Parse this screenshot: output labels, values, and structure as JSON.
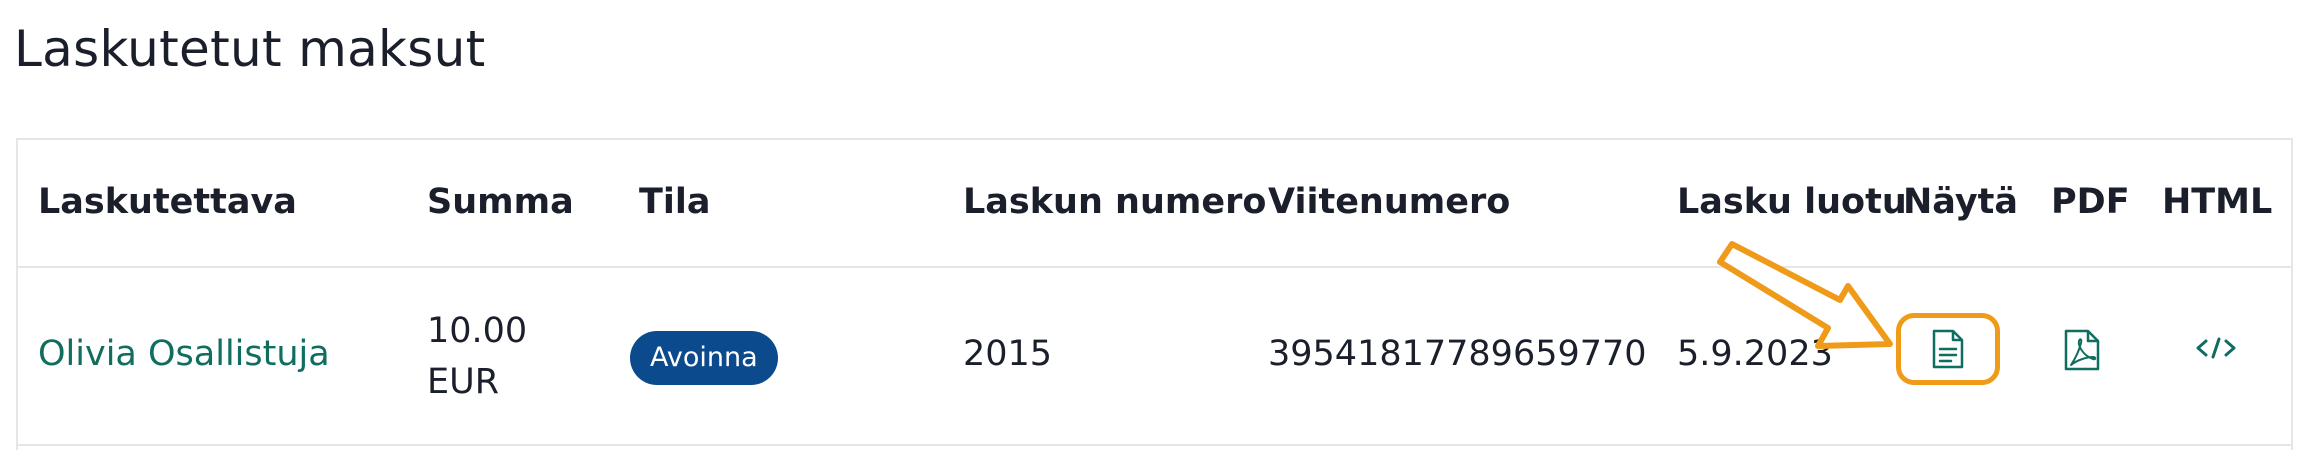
{
  "page": {
    "title": "Laskutetut maksut"
  },
  "table": {
    "headers": {
      "payer": "Laskutettava",
      "sum": "Summa",
      "status": "Tila",
      "invoice_number": "Laskun numero",
      "reference_number": "Viitenumero",
      "created": "Lasku luotu",
      "view": "Näytä",
      "pdf": "PDF",
      "html": "HTML"
    },
    "rows": [
      {
        "payer": "Olivia Osallistuja",
        "sum_amount": "10.00",
        "sum_currency": "EUR",
        "status": "Avoinna",
        "invoice_number": "2015",
        "reference_number": "39541817789659770",
        "created": "5.9.2023",
        "view_icon": "document-icon",
        "pdf_icon": "pdf-icon",
        "html_icon": "code-icon"
      }
    ]
  },
  "colors": {
    "link": "#0f6e60",
    "badge": "#0b4a8d",
    "highlight": "#ef9a19",
    "text": "#1a1f2b",
    "border": "#e6e6e6"
  }
}
